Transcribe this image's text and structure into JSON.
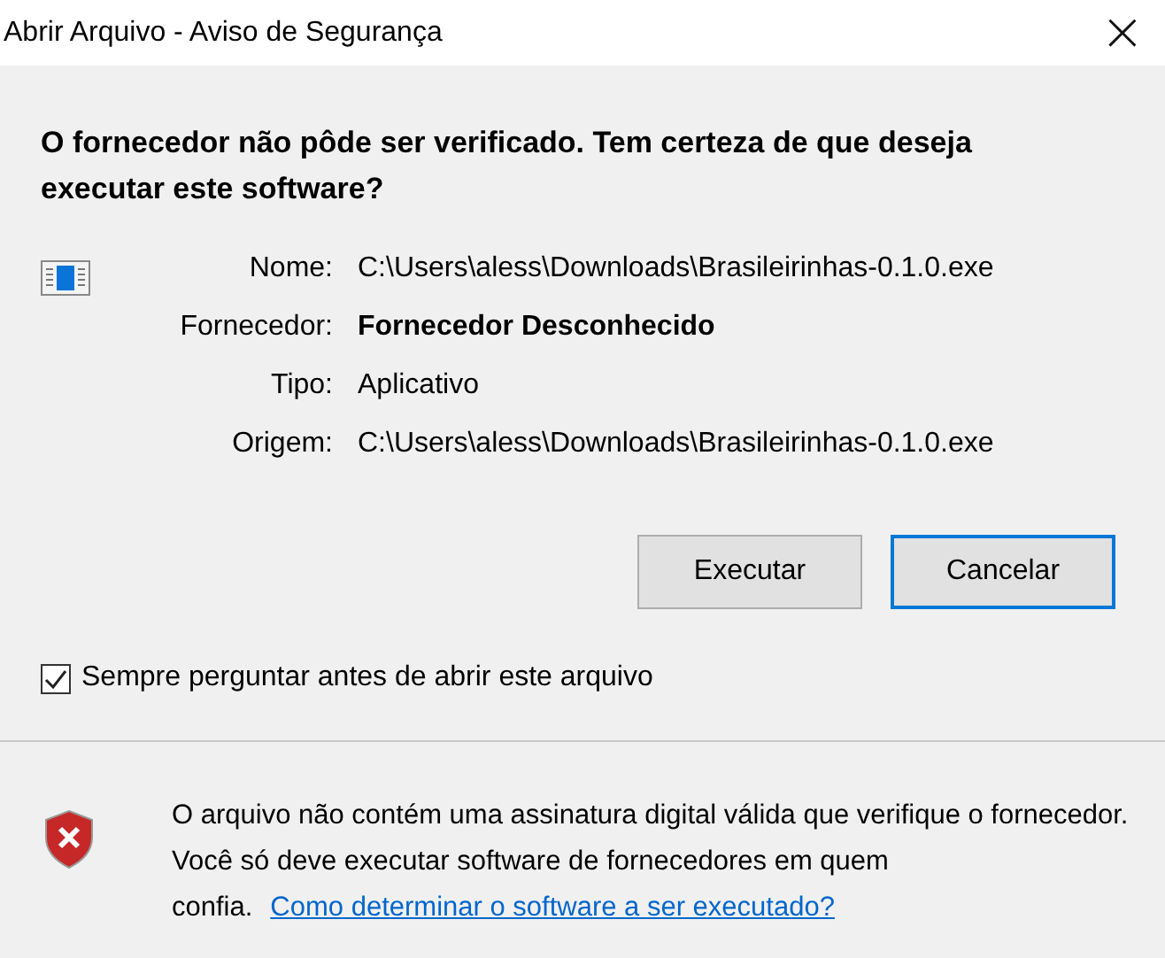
{
  "window": {
    "title": "Abrir Arquivo - Aviso de Segurança",
    "close": "×"
  },
  "heading": "O fornecedor não pôde ser verificado. Tem certeza de que deseja executar este software?",
  "fields": [
    {
      "label": "Nome:",
      "value": "C:\\Users\\aless\\Downloads\\Brasileirinhas-0.1.0.exe",
      "bold": false
    },
    {
      "label": "Fornecedor:",
      "value": "Fornecedor Desconhecido",
      "bold": true
    },
    {
      "label": "Tipo:",
      "value": "Aplicativo",
      "bold": false
    },
    {
      "label": "Origem:",
      "value": "C:\\Users\\aless\\Downloads\\Brasileirinhas-0.1.0.exe",
      "bold": false
    }
  ],
  "buttons": [
    {
      "label": "Executar",
      "selected": false
    },
    {
      "label": "Cancelar",
      "selected": true
    }
  ],
  "always_ask": {
    "label": "Sempre perguntar antes de abrir este arquivo",
    "checked": true
  },
  "warning": {
    "text": "O arquivo não contém uma assinatura digital válida que verifique o fornecedor. Você só deve executar software de fornecedores em quem confia.",
    "link": "Como determinar o software a ser executado?"
  }
}
